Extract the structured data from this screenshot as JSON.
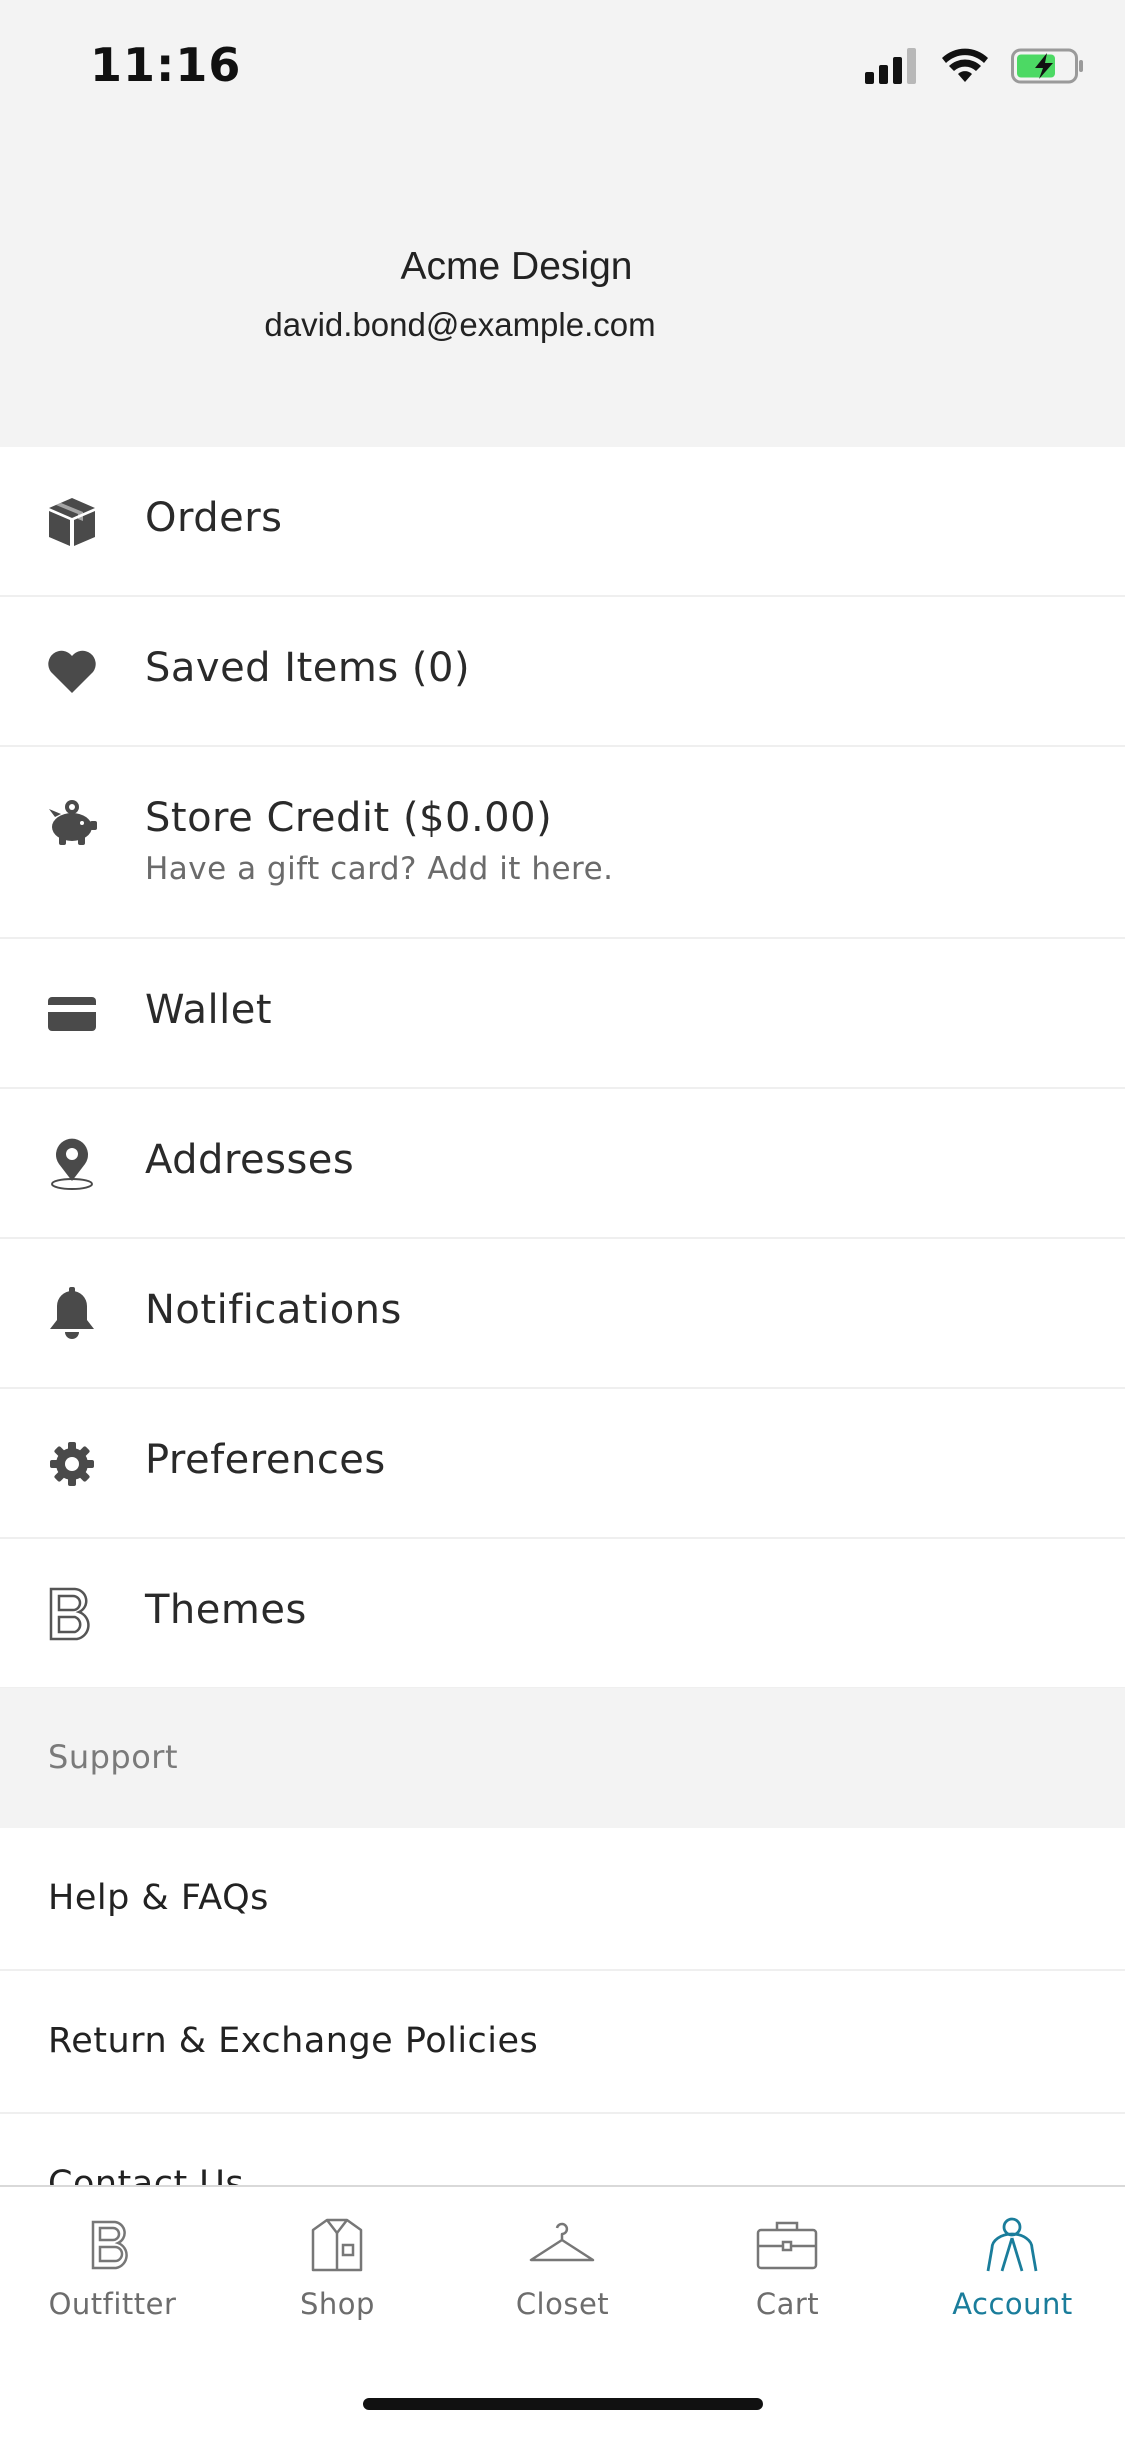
{
  "status_bar": {
    "time": "11:16",
    "icons": [
      "cellular-signal-icon",
      "wifi-icon",
      "battery-charging-icon"
    ]
  },
  "profile": {
    "name": "Acme Design",
    "email": "david.bond@example.com"
  },
  "menu": {
    "items": [
      {
        "label": "Orders",
        "icon": "box-icon"
      },
      {
        "label": "Saved Items (0)",
        "icon": "heart-icon"
      },
      {
        "label": "Store Credit ($0.00)",
        "sublabel": "Have a gift card? Add it here.",
        "icon": "piggy-bank-icon"
      },
      {
        "label": "Wallet",
        "icon": "credit-card-icon"
      },
      {
        "label": "Addresses",
        "icon": "location-pin-icon"
      },
      {
        "label": "Notifications",
        "icon": "bell-icon"
      },
      {
        "label": "Preferences",
        "icon": "gear-icon"
      },
      {
        "label": "Themes",
        "icon": "brand-b-icon"
      }
    ]
  },
  "support": {
    "title": "Support",
    "items": [
      {
        "label": "Help & FAQs"
      },
      {
        "label": "Return & Exchange Policies"
      },
      {
        "label": "Contact Us"
      }
    ]
  },
  "tab_bar": {
    "tabs": [
      {
        "label": "Outfitter",
        "icon": "brand-b-icon"
      },
      {
        "label": "Shop",
        "icon": "shirt-icon"
      },
      {
        "label": "Closet",
        "icon": "hanger-icon"
      },
      {
        "label": "Cart",
        "icon": "briefcase-icon"
      },
      {
        "label": "Account",
        "icon": "person-icon"
      }
    ],
    "active": "Account"
  },
  "colors": {
    "accent": "#1a7d9b",
    "header_bg": "#f3f3f3",
    "text": "#2b2b2b",
    "muted": "#6b6b6b",
    "battery_fill": "#4cd964"
  }
}
